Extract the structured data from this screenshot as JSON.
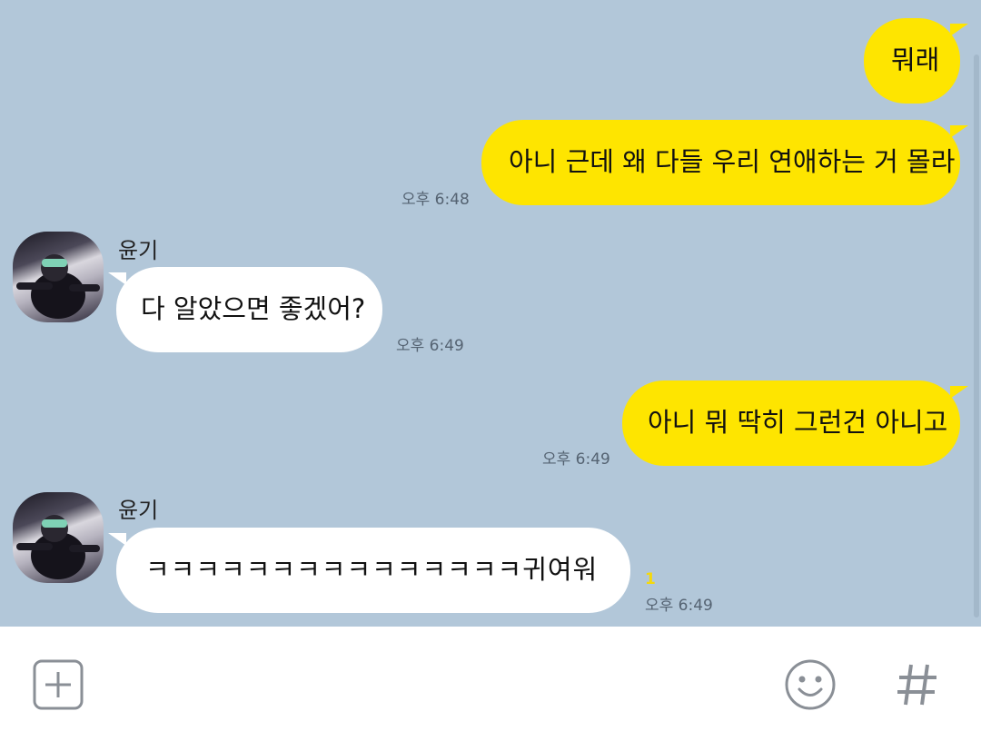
{
  "contact": {
    "name": "윤기"
  },
  "messages": [
    {
      "id": "m1",
      "sender": "me",
      "text": "뭐래",
      "time": ""
    },
    {
      "id": "m2",
      "sender": "me",
      "text": "아니 근데 왜 다들 우리 연애하는 거 몰라",
      "time": "오후 6:48"
    },
    {
      "id": "m3",
      "sender": "them",
      "name": "윤기",
      "text": "다 알았으면 좋겠어?",
      "time": "오후 6:49"
    },
    {
      "id": "m4",
      "sender": "me",
      "text": "아니 뭐 딱히 그런건 아니고",
      "time": "오후 6:49"
    },
    {
      "id": "m5",
      "sender": "them",
      "name": "윤기",
      "text": "ㅋㅋㅋㅋㅋㅋㅋㅋㅋㅋㅋㅋㅋㅋㅋ귀여워",
      "time": "오후 6:49",
      "unread": "1"
    }
  ],
  "composer": {
    "add_icon": "plus-square-icon",
    "emoji_icon": "smile-icon",
    "hash_icon": "hash-icon"
  },
  "colors": {
    "chat_bg": "#b2c7d9",
    "my_bubble": "#fee500",
    "their_bubble": "#ffffff",
    "time_text": "#556372"
  }
}
